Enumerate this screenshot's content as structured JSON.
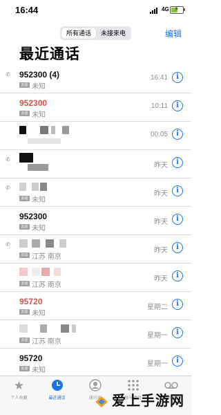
{
  "status": {
    "time": "16:44",
    "network": "4G"
  },
  "nav": {
    "tab_all": "所有通话",
    "tab_missed": "未接来电",
    "edit": "编辑"
  },
  "page_title": "最近通话",
  "rows": [
    {
      "number": "952300 (4)",
      "tag": "云话",
      "location": "未知",
      "time": "16:41",
      "missed": false,
      "outgoing": true
    },
    {
      "number": "952300",
      "tag": "云话",
      "location": "未知",
      "time": "10:11",
      "missed": true,
      "outgoing": false
    },
    {
      "number": "",
      "tag": "",
      "location": "",
      "time": "00:05",
      "missed": false,
      "outgoing": false,
      "redacted": true
    },
    {
      "number": "",
      "tag": "",
      "location": "",
      "time": "昨天",
      "missed": false,
      "outgoing": true,
      "redacted": true
    },
    {
      "number": "",
      "tag": "云话",
      "location": "未知",
      "time": "昨天",
      "missed": false,
      "outgoing": true,
      "redacted": true
    },
    {
      "number": "952300",
      "tag": "云话",
      "location": "未知",
      "time": "昨天",
      "missed": false,
      "outgoing": false
    },
    {
      "number": "",
      "tag": "云话",
      "location": "江苏 南京",
      "time": "昨天",
      "missed": false,
      "outgoing": true,
      "redacted": true
    },
    {
      "number": "",
      "tag": "云话",
      "location": "江苏 南京",
      "time": "昨天",
      "missed": true,
      "outgoing": false,
      "redacted": true
    },
    {
      "number": "95720",
      "tag": "云话",
      "location": "未知",
      "time": "星期二",
      "missed": true,
      "outgoing": false
    },
    {
      "number": "",
      "tag": "云话",
      "location": "江苏 南京",
      "time": "星期一",
      "missed": false,
      "outgoing": false,
      "redacted": true
    },
    {
      "number": "95720",
      "tag": "云话",
      "location": "未知",
      "time": "星期一",
      "missed": false,
      "outgoing": false
    }
  ],
  "tabs": [
    {
      "label": "个人收藏",
      "icon": "star-icon"
    },
    {
      "label": "最近通话",
      "icon": "clock-icon",
      "active": true
    },
    {
      "label": "通讯录",
      "icon": "contacts-icon"
    },
    {
      "label": "拨号键盘",
      "icon": "keypad-icon"
    },
    {
      "label": "语音留言",
      "icon": "voicemail-icon"
    }
  ],
  "watermark": "爱上手游网",
  "colors": {
    "accent": "#1a73e8",
    "missed": "#d9534f",
    "secondary": "#8e8e93"
  }
}
